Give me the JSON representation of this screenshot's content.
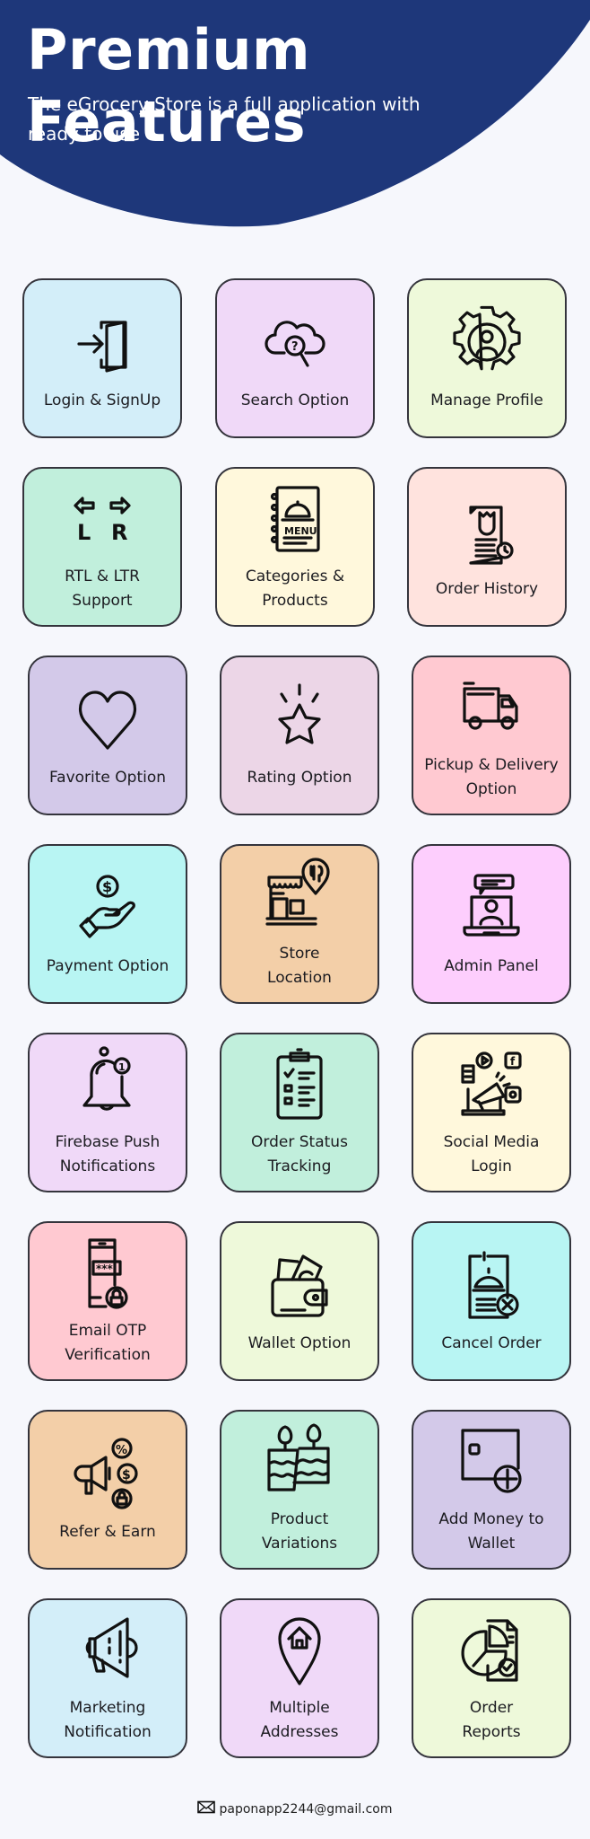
{
  "header": {
    "title": "Premium Features",
    "subtitle": "The eGrocery Store is a full application with ready to use",
    "background_color": "#1e377a"
  },
  "features": [
    {
      "label": "Login & SignUp",
      "icon": "login-door-icon",
      "color": "#d3eef9"
    },
    {
      "label": "Search Option",
      "icon": "cloud-search-icon",
      "color": "#f0d9f8"
    },
    {
      "label": "Manage Profile",
      "icon": "gear-profile-icon",
      "color": "#eef9da"
    },
    {
      "label": "RTL & LTR\nSupport",
      "icon": "rtl-ltr-arrows-icon",
      "color": "#c1efdc"
    },
    {
      "label": "Categories &\nProducts",
      "icon": "menu-book-icon",
      "color": "#fff8dc"
    },
    {
      "label": "Order History",
      "icon": "order-document-icon",
      "color": "#ffe3de"
    },
    {
      "label": "Favorite Option",
      "icon": "heart-icon",
      "color": "#d3c9e9"
    },
    {
      "label": "Rating Option",
      "icon": "star-icon",
      "color": "#ecd6e7"
    },
    {
      "label": "Pickup & Delivery\nOption",
      "icon": "delivery-truck-icon",
      "color": "#ffc9d1"
    },
    {
      "label": "Payment Option",
      "icon": "hand-coin-icon",
      "color": "#b8f5f3"
    },
    {
      "label": "Store\nLocation",
      "icon": "store-location-icon",
      "color": "#f3cfa8"
    },
    {
      "label": "Admin Panel",
      "icon": "admin-laptop-icon",
      "color": "#fdcefd"
    },
    {
      "label": "Firebase  Push\nNotifications",
      "icon": "bell-notification-icon",
      "color": "#f0d9f8"
    },
    {
      "label": "Order Status\nTracking",
      "icon": "clipboard-checklist-icon",
      "color": "#c1efdc"
    },
    {
      "label": "Social Media\nLogin",
      "icon": "social-media-megaphone-icon",
      "color": "#fff8dc"
    },
    {
      "label": "Email OTP\nVerification",
      "icon": "phone-otp-lock-icon",
      "color": "#ffc9d1"
    },
    {
      "label": "Wallet Option",
      "icon": "wallet-cash-icon",
      "color": "#eef9da"
    },
    {
      "label": "Cancel Order",
      "icon": "cancel-order-icon",
      "color": "#b8f5f3"
    },
    {
      "label": "Refer & Earn",
      "icon": "refer-megaphone-icon",
      "color": "#f3cfa8"
    },
    {
      "label": "Product\nVariations",
      "icon": "product-variations-icon",
      "color": "#c1efdc"
    },
    {
      "label": "Add Money to\nWallet",
      "icon": "wallet-add-icon",
      "color": "#d3c9e9"
    },
    {
      "label": "Marketing\nNotification",
      "icon": "megaphone-icon",
      "color": "#d3eef9"
    },
    {
      "label": "Multiple\nAddresses",
      "icon": "home-pin-icon",
      "color": "#f0d9f8"
    },
    {
      "label": "Order\nReports",
      "icon": "pie-report-icon",
      "color": "#eef9da"
    }
  ],
  "footer": {
    "email": "paponapp2244@gmail.com",
    "icon": "mail-icon"
  }
}
